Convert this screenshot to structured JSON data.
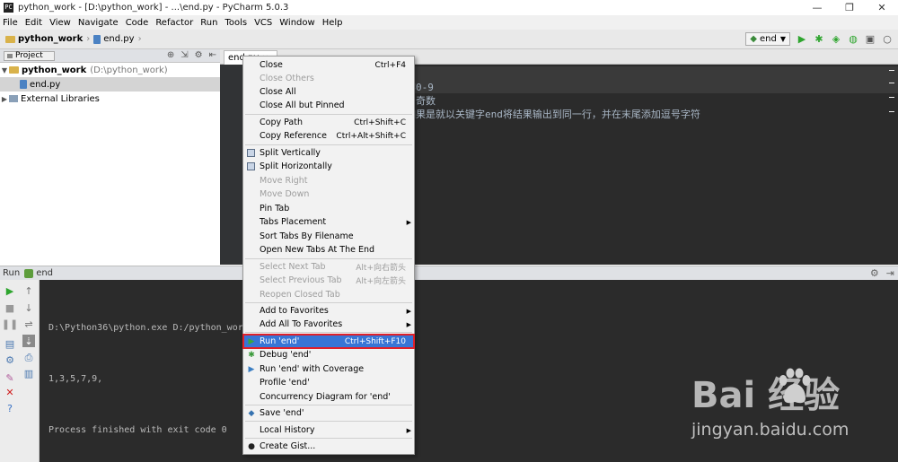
{
  "window": {
    "title": "python_work - [D:\\python_work] - ...\\end.py - PyCharm 5.0.3",
    "app_icon": "PC",
    "controls": [
      "—",
      "❐",
      "✕"
    ]
  },
  "menubar": [
    "File",
    "Edit",
    "View",
    "Navigate",
    "Code",
    "Refactor",
    "Run",
    "Tools",
    "VCS",
    "Window",
    "Help"
  ],
  "navbar": {
    "project": "python_work",
    "file": "end.py",
    "run_config": "end"
  },
  "project_pane": {
    "selector": "Project",
    "tree": [
      {
        "label": "python_work",
        "hint": "(D:\\python_work)",
        "expanded": true
      },
      {
        "label": "end.py",
        "selected": true
      },
      {
        "label": "External Libraries",
        "expanded": false
      }
    ]
  },
  "editor": {
    "tab_label": "end.py",
    "lines": [
      "字0-9",
      "为奇数",
      "如果是就以关键字end将结果输出到同一行，并在末尾添加逗号字符"
    ]
  },
  "run_window": {
    "label": "Run",
    "config": "end",
    "output": [
      "D:\\Python36\\python.exe D:/python_work",
      "1,3,5,7,9,",
      "Process finished with exit code 0"
    ]
  },
  "context_menu": {
    "items": [
      {
        "label": "Close",
        "shortcut": "Ctrl+F4"
      },
      {
        "label": "Close Others",
        "disabled": true
      },
      {
        "label": "Close All"
      },
      {
        "label": "Close All but Pinned"
      },
      {
        "label": "Copy Path",
        "shortcut": "Ctrl+Shift+C"
      },
      {
        "label": "Copy Reference",
        "shortcut": "Ctrl+Alt+Shift+C"
      },
      {
        "label": "Split Vertically",
        "icon": "split-vertical-icon"
      },
      {
        "label": "Split Horizontally",
        "icon": "split-horizontal-icon"
      },
      {
        "label": "Move Right",
        "disabled": true
      },
      {
        "label": "Move Down",
        "disabled": true
      },
      {
        "label": "Pin Tab"
      },
      {
        "label": "Tabs Placement",
        "submenu": true
      },
      {
        "label": "Sort Tabs By Filename"
      },
      {
        "label": "Open New Tabs At The End"
      },
      {
        "label": "Select Next Tab",
        "shortcut": "Alt+向右箭头",
        "disabled": true
      },
      {
        "label": "Select Previous Tab",
        "shortcut": "Alt+向左箭头",
        "disabled": true
      },
      {
        "label": "Reopen Closed Tab",
        "disabled": true
      },
      {
        "label": "Add to Favorites",
        "submenu": true
      },
      {
        "label": "Add All To Favorites",
        "submenu": true
      },
      {
        "label": "Run 'end'",
        "shortcut": "Ctrl+Shift+F10",
        "icon": "run-icon",
        "highlighted": true
      },
      {
        "label": "Debug 'end'",
        "icon": "debug-icon"
      },
      {
        "label": "Run 'end' with Coverage",
        "icon": "coverage-icon"
      },
      {
        "label": "Profile 'end'",
        "icon": "profile-icon"
      },
      {
        "label": "Concurrency Diagram for  'end'",
        "icon": "concurrency-icon"
      },
      {
        "label": "Save 'end'",
        "icon": "python-save-icon"
      },
      {
        "label": "Local History",
        "submenu": true
      },
      {
        "label": "Create Gist...",
        "icon": "github-icon"
      }
    ]
  },
  "watermark": {
    "logo": "Bai  经验",
    "url": "jingyan.baidu.com"
  },
  "colors": {
    "editor_bg": "#2b2b2b",
    "highlight": "#3875d6",
    "highlight_border": "#e0202a",
    "run_green": "#2ea52e"
  }
}
